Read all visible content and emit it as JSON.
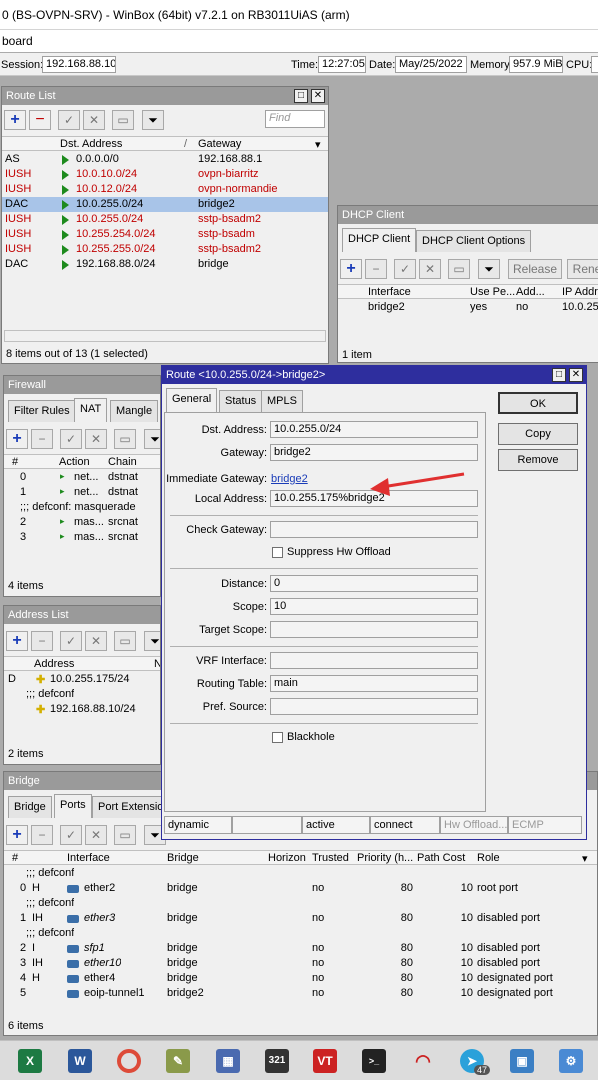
{
  "app": {
    "title": "0 (BS-OVPN-SRV) - WinBox (64bit) v7.2.1 on RB3011UiAS (arm)",
    "menu": "board"
  },
  "status": {
    "session_label": "Session:",
    "session_value": "192.168.88.10",
    "time_label": "Time:",
    "time_value": "12:27:05",
    "date_label": "Date:",
    "date_value": "May/25/2022",
    "memory_label": "Memory:",
    "memory_value": "957.9 MiB",
    "cpu_label": "CPU:"
  },
  "route_list": {
    "title": "Route List",
    "find_placeholder": "Find",
    "col_flags": "",
    "col_dst": "Dst. Address",
    "col_gateway": "Gateway",
    "rows": [
      {
        "flag": "AS",
        "dst": "0.0.0.0/0",
        "gw": "192.168.88.1",
        "red": false
      },
      {
        "flag": "IUSH",
        "dst": "10.0.10.0/24",
        "gw": "ovpn-biarritz",
        "red": true
      },
      {
        "flag": "IUSH",
        "dst": "10.0.12.0/24",
        "gw": "ovpn-normandie",
        "red": true
      },
      {
        "flag": "DAC",
        "dst": "10.0.255.0/24",
        "gw": "bridge2",
        "red": false
      },
      {
        "flag": "IUSH",
        "dst": "10.0.255.0/24",
        "gw": "sstp-bsadm2",
        "red": true
      },
      {
        "flag": "IUSH",
        "dst": "10.255.254.0/24",
        "gw": "sstp-bsadm",
        "red": true
      },
      {
        "flag": "IUSH",
        "dst": "10.255.255.0/24",
        "gw": "sstp-bsadm2",
        "red": true
      },
      {
        "flag": "DAC",
        "dst": "192.168.88.0/24",
        "gw": "bridge",
        "red": false
      }
    ],
    "footer": "8 items out of 13 (1 selected)"
  },
  "dhcp": {
    "title": "DHCP Client",
    "tab1": "DHCP Client",
    "tab2": "DHCP Client Options",
    "release": "Release",
    "renew": "Rene",
    "col_iface": "Interface",
    "col_use": "Use Pe...",
    "col_add": "Add...",
    "col_ip": "IP Addre",
    "row_iface": "bridge2",
    "row_use": "yes",
    "row_add": "no",
    "row_ip": "10.0.25",
    "footer": "1 item"
  },
  "firewall": {
    "title": "Firewall",
    "tab1": "Filter Rules",
    "tab2": "NAT",
    "tab3": "Mangle",
    "col_num": "#",
    "col_action": "Action",
    "col_chain": "Chain",
    "rows": [
      {
        "num": "0",
        "action": "net...",
        "chain": "dstnat"
      },
      {
        "num": "1",
        "action": "net...",
        "chain": "dstnat"
      },
      {
        "num": "",
        "action": ";;; defconf: masquerade",
        "chain": ""
      },
      {
        "num": "2",
        "action": "mas...",
        "chain": "srcnat"
      },
      {
        "num": "3",
        "action": "mas...",
        "chain": "srcnat"
      }
    ],
    "footer": "4 items"
  },
  "address_list": {
    "title": "Address List",
    "col_address": "Address",
    "col_n": "N",
    "row1_flag": "D",
    "row1_addr": "10.0.255.175/24",
    "comment": ";;; defconf",
    "row2_addr": "192.168.88.10/24",
    "footer": "2 items"
  },
  "bridge": {
    "title": "Bridge",
    "tab1": "Bridge",
    "tab2": "Ports",
    "tab3": "Port Extension",
    "col_num": "#",
    "col_iface": "Interface",
    "col_bridge": "Bridge",
    "col_horizon": "Horizon",
    "col_trusted": "Trusted",
    "col_priority": "Priority (h...",
    "col_cost": "Path Cost",
    "col_role": "Role",
    "rows": [
      {
        "comment": ";;; defconf"
      },
      {
        "num": "0",
        "flag": "H",
        "iface": "ether2",
        "bridge": "bridge",
        "trusted": "no",
        "prio": "80",
        "cost": "10",
        "role": "root port",
        "italic": false
      },
      {
        "comment": ";;; defconf"
      },
      {
        "num": "1",
        "flag": "IH",
        "iface": "ether3",
        "bridge": "bridge",
        "trusted": "no",
        "prio": "80",
        "cost": "10",
        "role": "disabled port",
        "italic": true
      },
      {
        "comment": ";;; defconf"
      },
      {
        "num": "2",
        "flag": "I",
        "iface": "sfp1",
        "bridge": "bridge",
        "trusted": "no",
        "prio": "80",
        "cost": "10",
        "role": "disabled port",
        "italic": true
      },
      {
        "num": "3",
        "flag": "IH",
        "iface": "ether10",
        "bridge": "bridge",
        "trusted": "no",
        "prio": "80",
        "cost": "10",
        "role": "disabled port",
        "italic": true
      },
      {
        "num": "4",
        "flag": "H",
        "iface": "ether4",
        "bridge": "bridge",
        "trusted": "no",
        "prio": "80",
        "cost": "10",
        "role": "designated port",
        "italic": false
      },
      {
        "num": "5",
        "flag": "",
        "iface": "eoip-tunnel1",
        "bridge": "bridge2",
        "trusted": "no",
        "prio": "80",
        "cost": "10",
        "role": "designated port",
        "italic": false
      }
    ],
    "footer": "6 items"
  },
  "route_dialog": {
    "title": "Route <10.0.255.0/24->bridge2>",
    "tab_general": "General",
    "tab_status": "Status",
    "tab_mpls": "MPLS",
    "ok": "OK",
    "copy": "Copy",
    "remove": "Remove",
    "dst_label": "Dst. Address:",
    "dst_value": "10.0.255.0/24",
    "gw_label": "Gateway:",
    "gw_value": "bridge2",
    "igw_label": "Immediate Gateway:",
    "igw_value": "bridge2",
    "local_label": "Local Address:",
    "local_value": "10.0.255.175%bridge2",
    "check_label": "Check Gateway:",
    "check_value": "",
    "suppress_label": "Suppress Hw Offload",
    "distance_label": "Distance:",
    "distance_value": "0",
    "scope_label": "Scope:",
    "scope_value": "10",
    "target_label": "Target Scope:",
    "target_value": "",
    "vrf_label": "VRF Interface:",
    "vrf_value": "",
    "rt_label": "Routing Table:",
    "rt_value": "main",
    "pref_label": "Pref. Source:",
    "pref_value": "",
    "blackhole_label": "Blackhole",
    "sb_dynamic": "dynamic",
    "sb_active": "active",
    "sb_connect": "connect",
    "sb_hw": "Hw Offload...",
    "sb_ecmp": "ECMP",
    "arrow_color": "#e03030"
  },
  "taskbar": {
    "icons": [
      "excel-icon",
      "word-icon",
      "chrome-icon",
      "notepad-icon",
      "calculator-icon",
      "app-321-icon",
      "vt-icon",
      "terminal-icon",
      "network-icon",
      "telegram-icon",
      "app-icon",
      "remote-icon"
    ],
    "telegram_badge": "47"
  }
}
